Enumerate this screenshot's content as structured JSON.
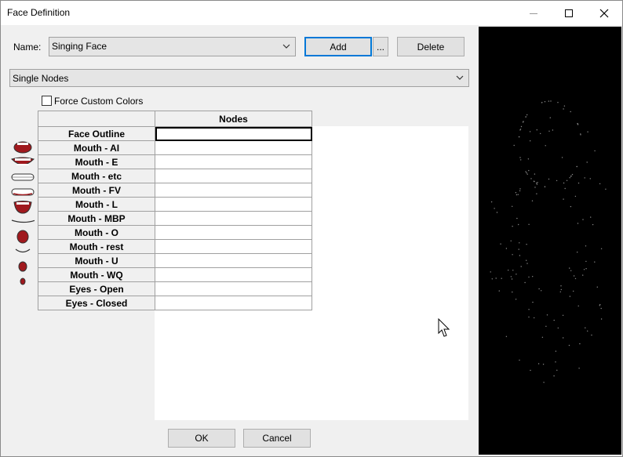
{
  "window": {
    "title": "Face Definition"
  },
  "form": {
    "name_label": "Name:",
    "name_value": "Singing Face",
    "add_label": "Add",
    "more_label": "...",
    "delete_label": "Delete",
    "mode_value": "Single Nodes",
    "force_colors_label": "Force Custom Colors"
  },
  "grid": {
    "column_header": "Nodes",
    "rows": [
      {
        "label": "Face Outline",
        "icon": "none"
      },
      {
        "label": "Mouth - AI",
        "icon": "mouth-open-wide"
      },
      {
        "label": "Mouth - E",
        "icon": "mouth-e"
      },
      {
        "label": "Mouth - etc",
        "icon": "mouth-teeth"
      },
      {
        "label": "Mouth - FV",
        "icon": "mouth-teeth-lip"
      },
      {
        "label": "Mouth - L",
        "icon": "mouth-l"
      },
      {
        "label": "Mouth - MBP",
        "icon": "mouth-closed-line"
      },
      {
        "label": "Mouth - O",
        "icon": "mouth-o"
      },
      {
        "label": "Mouth - rest",
        "icon": "mouth-rest"
      },
      {
        "label": "Mouth - U",
        "icon": "mouth-u"
      },
      {
        "label": "Mouth - WQ",
        "icon": "mouth-wq"
      },
      {
        "label": "Eyes - Open",
        "icon": "none"
      },
      {
        "label": "Eyes - Closed",
        "icon": "none"
      }
    ]
  },
  "footer": {
    "ok_label": "OK",
    "cancel_label": "Cancel"
  },
  "colors": {
    "accent": "#0078d7",
    "mouth": "#a0191e",
    "preview_bg": "#000000"
  }
}
